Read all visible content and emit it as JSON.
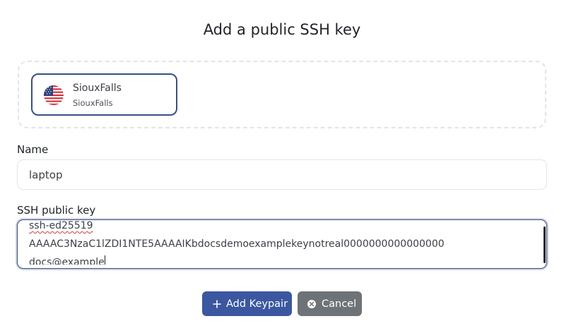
{
  "dialog": {
    "title": "Add a public SSH key"
  },
  "region": {
    "name": "SiouxFalls",
    "subtitle": "SiouxFalls",
    "flag_icon": "us-flag-icon"
  },
  "name_field": {
    "label": "Name",
    "value": "laptop"
  },
  "key_field": {
    "label": "SSH public key",
    "line1": "ssh-ed25519",
    "line2": "AAAAC3NzaC1lZDI1NTE5AAAAIKbdocsdemoexamplekeynotreal0000000000000000",
    "line3": "docs@example"
  },
  "buttons": {
    "add_label": "Add Keypair",
    "cancel_label": "Cancel"
  },
  "colors": {
    "primary": "#3b57a0",
    "secondary": "#6e7378",
    "selected_border": "#3b4f86"
  }
}
